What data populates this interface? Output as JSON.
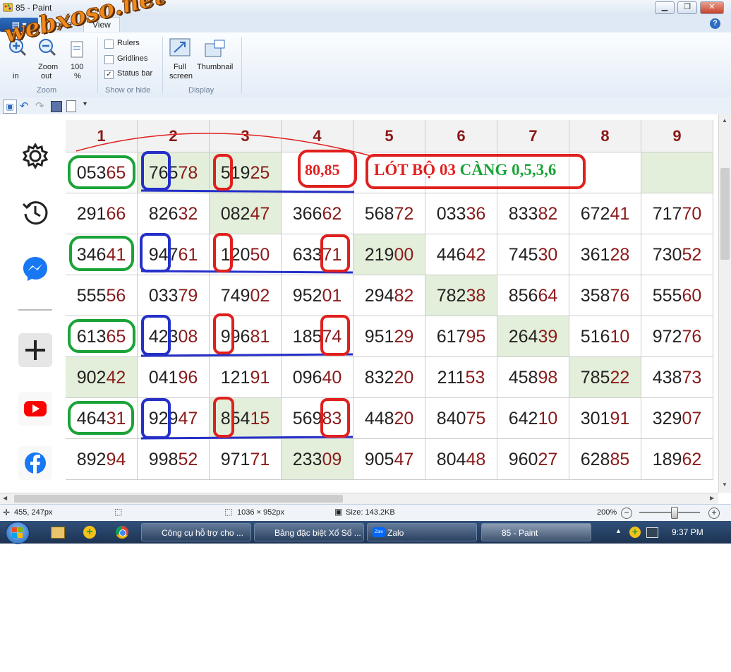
{
  "window": {
    "title": "85 - Paint",
    "minimize": "▁",
    "maximize": "❐",
    "close": "✕"
  },
  "watermark": "webxoso.net",
  "tabs": {
    "file": "▤ ▾",
    "home": "Home",
    "view": "View"
  },
  "ribbon": {
    "zoom_in": "in",
    "zoom_out_1": "Zoom",
    "zoom_out_2": "out",
    "hundred_1": "100",
    "hundred_2": "%",
    "group_zoom": "Zoom",
    "rulers": "Rulers",
    "gridlines": "Gridlines",
    "statusbar": "Status bar",
    "statusbar_checked": "✓",
    "group_show": "Show or hide",
    "fullscreen_1": "Full",
    "fullscreen_2": "screen",
    "thumbnail": "Thumbnail",
    "group_display": "Display"
  },
  "grid": {
    "headers": [
      "1",
      "2",
      "3",
      "4",
      "5",
      "6",
      "7",
      "8",
      "9"
    ],
    "rows": [
      [
        "05365",
        "76578",
        "51925",
        "",
        "",
        "",
        "",
        "",
        ""
      ],
      [
        "29166",
        "82632",
        "08247",
        "36662",
        "56872",
        "03336",
        "83382",
        "67241",
        "71770"
      ],
      [
        "34641",
        "94761",
        "12050",
        "63371",
        "21900",
        "44642",
        "74530",
        "36128",
        "73052"
      ],
      [
        "55556",
        "03379",
        "74902",
        "95201",
        "29482",
        "78238",
        "85664",
        "35876",
        "55560"
      ],
      [
        "61365",
        "42308",
        "99681",
        "18574",
        "95129",
        "61795",
        "26439",
        "51610",
        "97276"
      ],
      [
        "90242",
        "04196",
        "12191",
        "09640",
        "83220",
        "21153",
        "45898",
        "78522",
        "43873"
      ],
      [
        "46431",
        "92947",
        "85415",
        "56983",
        "44820",
        "84075",
        "64210",
        "30191",
        "32907"
      ],
      [
        "89294",
        "99852",
        "97171",
        "23309",
        "90547",
        "80448",
        "96027",
        "62885",
        "18962"
      ]
    ]
  },
  "annotations": {
    "red_numbers": "80,85",
    "note_red": "LÓT BỘ 03 ",
    "note_green": "CÀNG 0,5,3,6"
  },
  "statusbar": {
    "cursor": "455, 247px",
    "dimensions": "1036 × 952px",
    "size": "Size: 143.2KB",
    "zoom": "200%"
  },
  "taskbar": {
    "items": [
      "Công cụ hỗ trợ cho ...",
      "Bảng đặc biệt Xổ Số ...",
      "Zalo",
      "85 - Paint"
    ],
    "zalo_icon": "Zalo",
    "clock": "9:37 PM"
  },
  "colors": {
    "green_cell": "#e3efda",
    "header_text": "#8b1a1a",
    "annotation_red": "#e0201e",
    "annotation_green": "#1aa338",
    "annotation_blue": "#2630c8"
  }
}
